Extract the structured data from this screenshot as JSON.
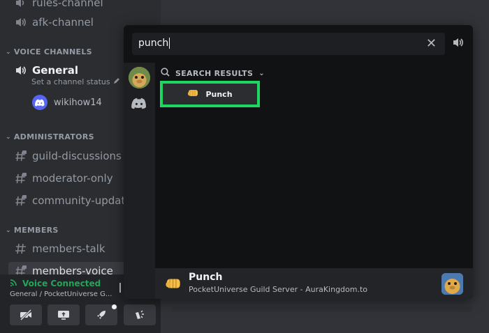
{
  "sidebar": {
    "top_channel": "rules-channel",
    "afk_channel": "afk-channel",
    "voice_category": "VOICE CHANNELS",
    "general": "General",
    "general_status": "Set a channel status",
    "voice_user": "wikihow14",
    "admin_category": "ADMINISTRATORS",
    "admin_channels": [
      "guild-discussions",
      "moderator-only",
      "community-updates"
    ],
    "members_category": "MEMBERS",
    "members_channels": [
      "members-talk",
      "members-voice"
    ]
  },
  "voice": {
    "status": "Voice Connected",
    "location": "General / PocketUniverse G..."
  },
  "soundboard": {
    "search_value": "punch",
    "results_heading": "SEARCH RESULTS",
    "result_label": "Punch",
    "footer_title": "Punch",
    "footer_subtitle": "PocketUniverse Guild Server - AuraKingdom.to"
  },
  "colors": {
    "highlight": "#1ed760",
    "voice_connected": "#23a559",
    "blurple": "#5865f2"
  },
  "icons": [
    "speaker-icon",
    "hashtag-lock-icon",
    "discord-icon",
    "search-icon",
    "close-icon",
    "volume-icon",
    "fist-emoji-icon",
    "signal-icon"
  ]
}
